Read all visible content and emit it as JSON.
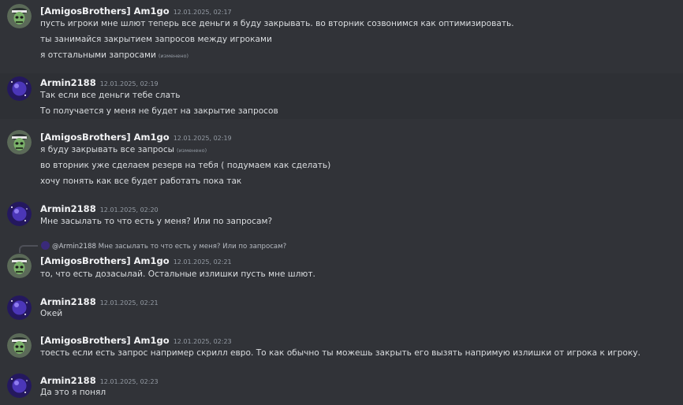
{
  "users": {
    "amigo": "[AmigosBrothers] Am1go",
    "armin": "Armin2188"
  },
  "edited_label": "(изменено)",
  "messages": [
    {
      "author": "[AmigosBrothers] Am1go",
      "time": "12.01.2025, 02:17",
      "lines": [
        "пусть игроки мне шлют теперь все деньги я буду закрывать. во вторник созвонимся как оптимизировать.",
        "ты занимайся закрытием запросов между игроками",
        "я отстальными запросами"
      ]
    },
    {
      "author": "Armin2188",
      "time": "12.01.2025, 02:19",
      "lines": [
        "Так если все деньги тебе слать",
        "То получается у меня не будет на закрытие запросов"
      ]
    },
    {
      "author": "[AmigosBrothers] Am1go",
      "time": "12.01.2025, 02:19",
      "lines": [
        "я буду закрывать все запросы",
        "во вторник уже сделаем резерв на тебя ( подумаем как сделать)",
        "хочу понять как все будет работать пока так"
      ]
    },
    {
      "author": "Armin2188",
      "time": "12.01.2025, 02:20",
      "lines": [
        "Мне засылать то что есть у меня? Или по запросам?"
      ]
    },
    {
      "author": "[AmigosBrothers] Am1go",
      "time": "12.01.2025, 02:21",
      "reply": {
        "name": "@Armin2188",
        "text": "Мне засылать то что есть у меня? Или по запросам?"
      },
      "lines": [
        "то, что есть дозасылай.  Остальные излишки пусть мне шлют."
      ]
    },
    {
      "author": "Armin2188",
      "time": "12.01.2025, 02:21",
      "lines": [
        "Окей"
      ]
    },
    {
      "author": "[AmigosBrothers] Am1go",
      "time": "12.01.2025, 02:23",
      "lines": [
        "тоесть если есть запрос например скрилл евро. То как обычно ты можешь закрыть его вызять напримую излишки от игрока к игроку."
      ]
    },
    {
      "author": "Armin2188",
      "time": "12.01.2025, 02:23",
      "lines": [
        "Да это я понял"
      ]
    }
  ]
}
